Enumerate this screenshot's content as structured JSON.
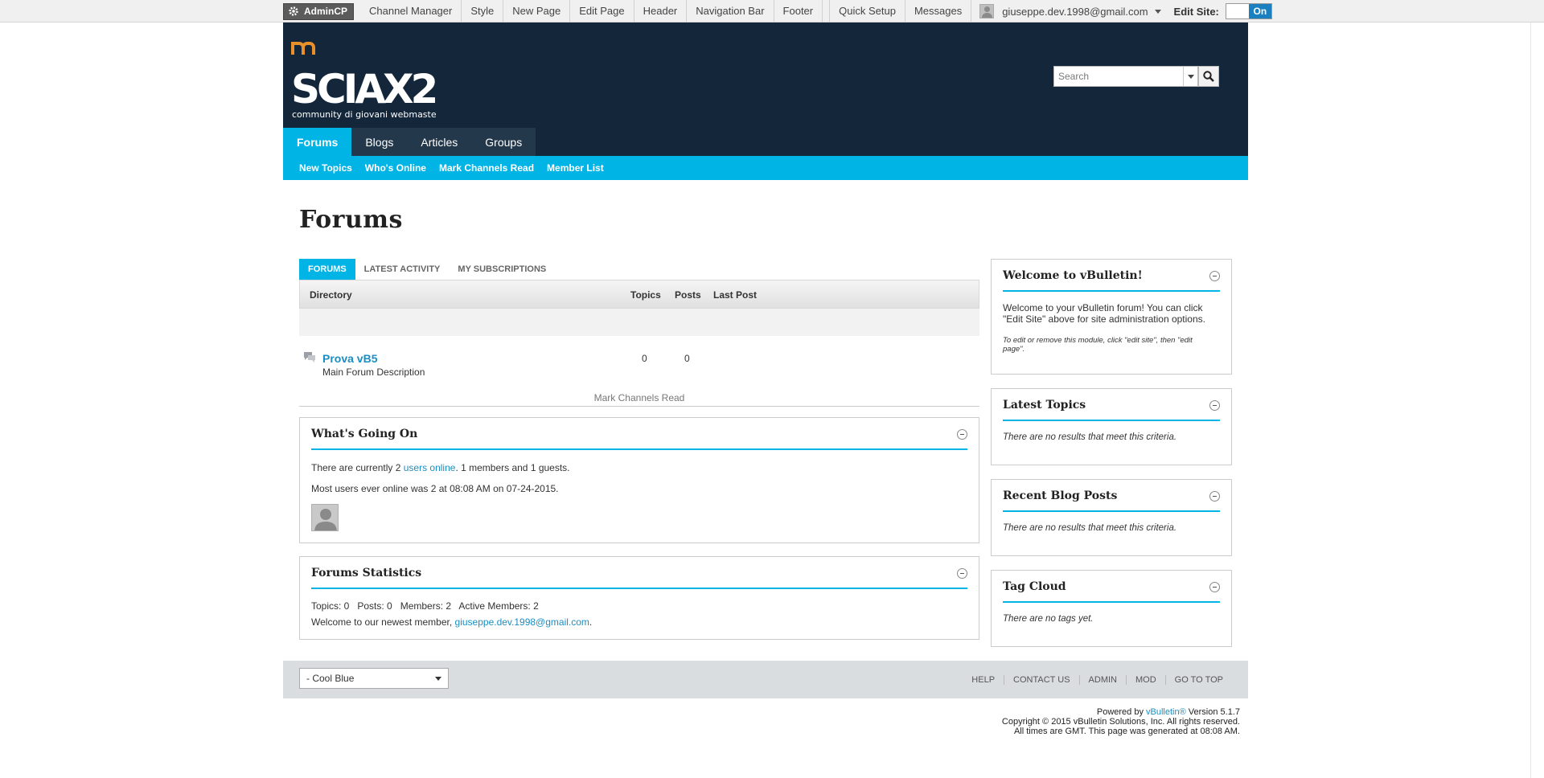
{
  "adminbar": {
    "admincp": "AdminCP",
    "items": [
      "Channel Manager",
      "Style",
      "New Page",
      "Edit Page",
      "Header",
      "Navigation Bar",
      "Footer"
    ],
    "items2": [
      "Quick Setup",
      "Messages"
    ],
    "user": "giuseppe.dev.1998@gmail.com",
    "edit_site_label": "Edit Site:",
    "toggle_on": "On"
  },
  "header": {
    "search_placeholder": "Search",
    "tabs": [
      "Forums",
      "Blogs",
      "Articles",
      "Groups"
    ],
    "subnav": [
      "New Topics",
      "Who's Online",
      "Mark Channels Read",
      "Member List"
    ]
  },
  "page_title": "Forums",
  "forum_tabs": [
    "FORUMS",
    "LATEST ACTIVITY",
    "MY SUBSCRIPTIONS"
  ],
  "directory": {
    "columns": [
      "Directory",
      "Topics",
      "Posts",
      "Last Post"
    ],
    "forums": [
      {
        "name": "Prova vB5",
        "description": "Main Forum Description",
        "topics": "0",
        "posts": "0"
      }
    ],
    "mark_read": "Mark Channels Read"
  },
  "whats_going_on": {
    "title": "What's Going On",
    "online_prefix": "There are currently 2 ",
    "online_link": "users online",
    "online_suffix": ". 1 members and 1 guests.",
    "most_online": "Most users ever online was 2 at 08:08 AM on 07-24-2015."
  },
  "forum_stats": {
    "title": "Forums Statistics",
    "stats": "Topics: 0   Posts: 0   Members: 2   Active Members: 2",
    "newest_prefix": "Welcome to our newest member, ",
    "newest_member": "giuseppe.dev.1998@gmail.com",
    "newest_suffix": "."
  },
  "sidebar": {
    "welcome": {
      "title": "Welcome to vBulletin!",
      "line1": "Welcome to your vBulletin forum! You can click",
      "line2": "\"Edit Site\" above for site administration options.",
      "note1": "To edit or remove this module, click \"edit site\", then \"edit",
      "note2": "page\"."
    },
    "latest_topics": {
      "title": "Latest Topics",
      "text": "There are no results that meet this criteria."
    },
    "recent_blog": {
      "title": "Recent Blog Posts",
      "text": "There are no results that meet this criteria."
    },
    "tag_cloud": {
      "title": "Tag Cloud",
      "text": "There are no tags yet."
    }
  },
  "footer": {
    "style_select": "- Cool Blue",
    "links": [
      "HELP",
      "CONTACT US",
      "ADMIN",
      "MOD",
      "GO TO TOP"
    ],
    "powered_prefix": "Powered by ",
    "powered_link": "vBulletin®",
    "powered_suffix": " Version 5.1.7",
    "copyright": "Copyright © 2015 vBulletin Solutions, Inc. All rights reserved.",
    "times": "All times are GMT. This page was generated at 08:08 AM."
  },
  "logo": {
    "text": "SCIAX2",
    "tagline": "community di giovani webmaster"
  },
  "colors": {
    "accent": "#00b4e6",
    "header_bg": "#13263a",
    "link": "#1a8ec2"
  }
}
